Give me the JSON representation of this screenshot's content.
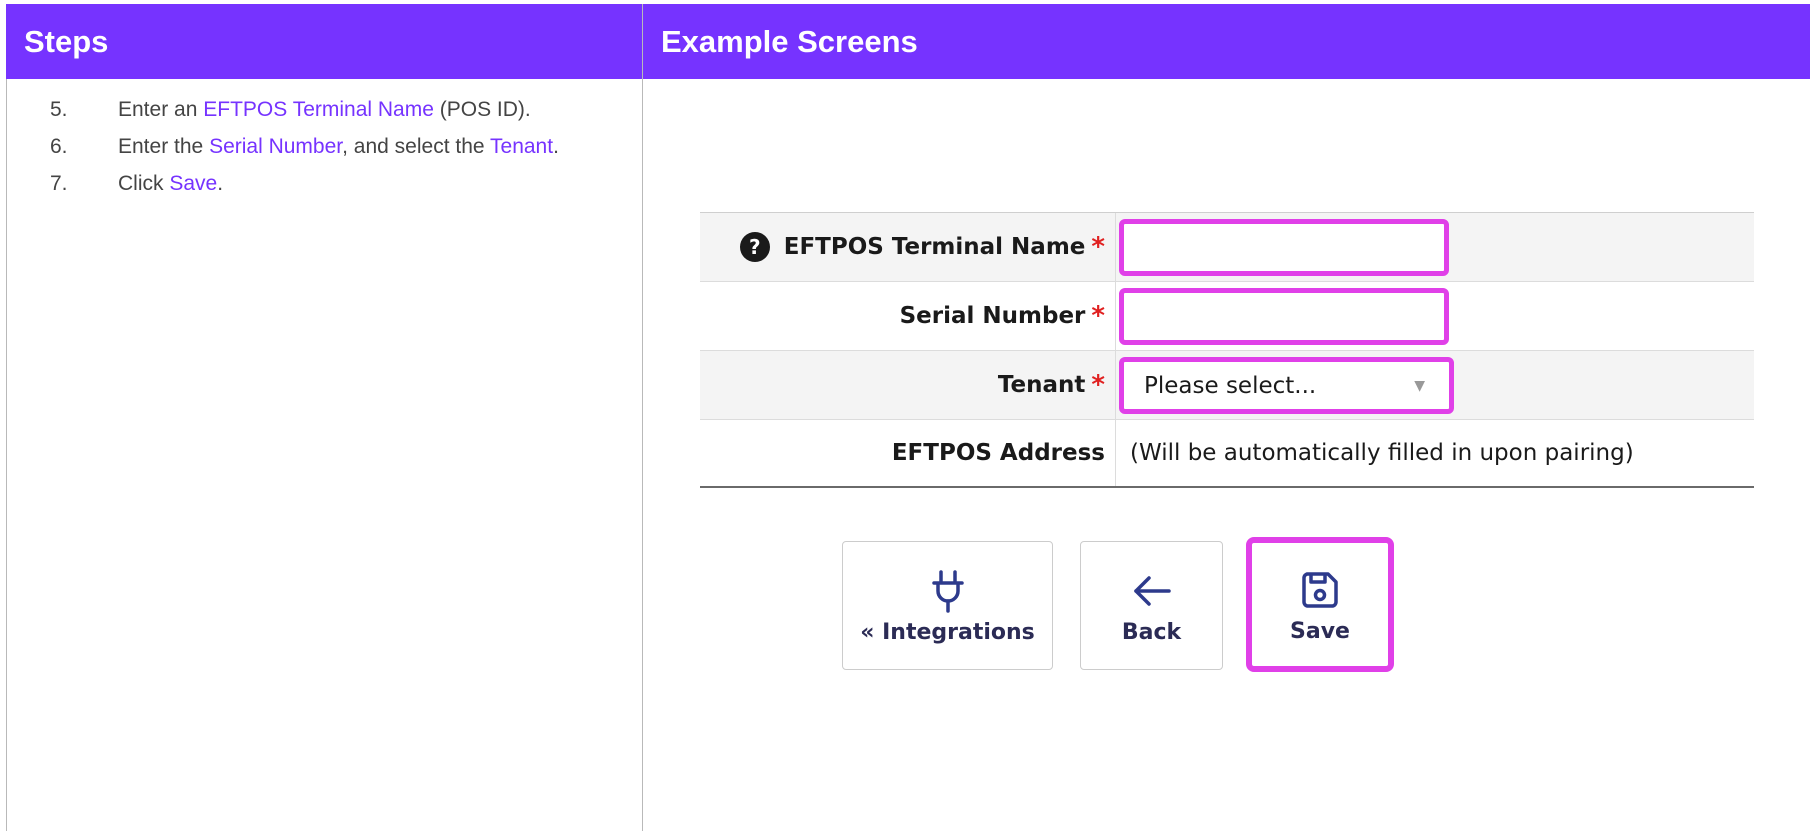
{
  "header": {
    "steps": "Steps",
    "example_screens": "Example Screens"
  },
  "steps": [
    {
      "num": "5.",
      "pre": "Enter an ",
      "link": "EFTPOS Terminal Name",
      "post": " (POS ID)."
    },
    {
      "num": "6.",
      "pre": "Enter the ",
      "link": "Serial Number",
      "mid": ", and select the ",
      "link2": "Tenant",
      "post": "."
    },
    {
      "num": "7.",
      "pre": "Click ",
      "link": "Save",
      "post": "."
    }
  ],
  "form": {
    "terminal_name_label": "EFTPOS Terminal Name",
    "terminal_name_value": "",
    "serial_number_label": "Serial Number",
    "serial_number_value": "",
    "tenant_label": "Tenant",
    "tenant_selected": "Please select...",
    "eftpos_address_label": "EFTPOS Address",
    "eftpos_address_value": "(Will be automatically filled in upon pairing)",
    "required_marker": "*"
  },
  "buttons": {
    "integrations": "« Integrations",
    "back": "Back",
    "save": "Save"
  },
  "colors": {
    "accent": "#7633ff",
    "highlight": "#e040e8",
    "required": "#e02020"
  },
  "icons": {
    "help": "question-circle-icon",
    "integrations": "plug-icon",
    "back": "arrow-left-icon",
    "save": "floppy-disk-icon"
  }
}
